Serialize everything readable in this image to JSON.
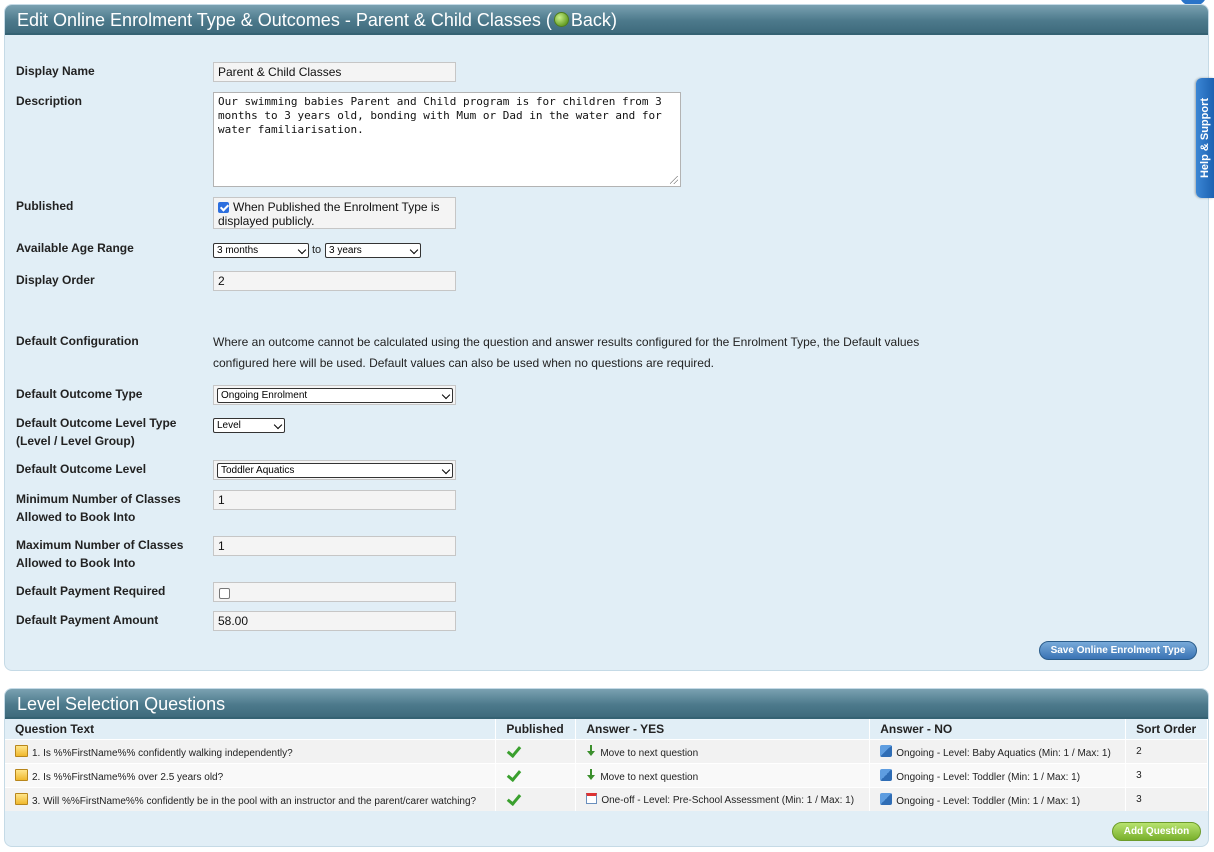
{
  "edit_panel": {
    "title_prefix": "Edit Online Enrolment Type & Outcomes - Parent & Child Classes (",
    "back_label": "Back",
    "title_suffix": ")",
    "display_name_label": "Display Name",
    "display_name_value": "Parent & Child Classes",
    "description_label": "Description",
    "description_value": "Our swimming babies Parent and Child program is for children from 3 months to 3 years old, bonding with Mum or Dad in the water and for water familiarisation.",
    "published_label": "Published",
    "published_checked": true,
    "published_text": "When Published the Enrolment Type is displayed publicly.",
    "age_range_label": "Available Age Range",
    "age_from": "3 months",
    "age_to_word": "to",
    "age_to": "3 years",
    "display_order_label": "Display Order",
    "display_order_value": "2",
    "default_config_label": "Default Configuration",
    "default_config_text_1": "Where an outcome cannot be calculated using the question and answer results configured for the Enrolment Type, the Default values",
    "default_config_text_2": "configured here will be used. Default values can also be used when no questions are required.",
    "outcome_type_label": "Default Outcome Type",
    "outcome_type_value": "Ongoing Enrolment",
    "outcome_level_type_label_1": "Default Outcome Level Type",
    "outcome_level_type_label_2": "(Level / Level Group)",
    "outcome_level_type_value": "Level",
    "outcome_level_label": "Default Outcome Level",
    "outcome_level_value": "Toddler Aquatics",
    "min_classes_label_1": "Minimum Number of Classes",
    "min_classes_label_2": "Allowed to Book Into",
    "min_classes_value": "1",
    "max_classes_label_1": "Maximum Number of Classes",
    "max_classes_label_2": "Allowed to Book Into",
    "max_classes_value": "1",
    "payment_required_label": "Default Payment Required",
    "payment_required_checked": false,
    "payment_amount_label": "Default Payment Amount",
    "payment_amount_value": "58.00",
    "save_button_label": "Save Online Enrolment Type"
  },
  "help_tab_label": "Help & Support",
  "questions_panel": {
    "title": "Level Selection Questions",
    "columns": [
      "Question Text",
      "Published",
      "Answer - YES",
      "Answer - NO",
      "Sort Order"
    ],
    "rows": [
      {
        "question": "1. Is %%FirstName%% confidently walking independently?",
        "published": true,
        "answer_yes": "Move to next question",
        "answer_yes_icon": "arrow-down-icon",
        "answer_no": "Ongoing - Level: Baby Aquatics (Min: 1 / Max: 1)",
        "sort_order": "2"
      },
      {
        "question": "2. Is %%FirstName%% over 2.5 years old?",
        "published": true,
        "answer_yes": "Move to next question",
        "answer_yes_icon": "arrow-down-icon",
        "answer_no": "Ongoing - Level: Toddler (Min: 1 / Max: 1)",
        "sort_order": "3"
      },
      {
        "question": "3. Will %%FirstName%% confidently be in the pool with an instructor and the parent/carer watching?",
        "published": true,
        "answer_yes": "One-off - Level: Pre-School Assessment (Min: 1 / Max: 1)",
        "answer_yes_icon": "calendar-icon",
        "answer_no": "Ongoing - Level: Toddler (Min: 1 / Max: 1)",
        "sort_order": "3"
      }
    ],
    "add_button_label": "Add Question"
  },
  "colors": {
    "panel_bg": "#e1eef6",
    "header_bg": "#4d7a8c",
    "save_button": "#3a73b4",
    "add_button": "#79b02c"
  }
}
